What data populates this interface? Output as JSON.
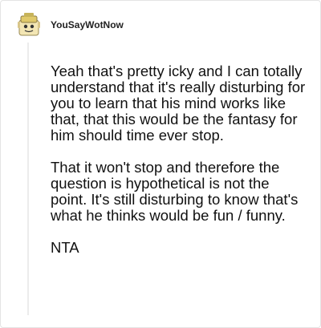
{
  "comment": {
    "author": {
      "username": "YouSayWotNow",
      "avatar_icon": "snoo-avatar-icon"
    },
    "paragraphs": [
      "Yeah that's pretty icky and I can totally understand that it's really disturbing for you to learn that his mind works like that, that this would be the fantasy for him should time ever stop.",
      "That it won't stop and therefore the question is hypothetical is not the point. It's still disturbing to know that's what he thinks would be fun / funny.",
      "NTA"
    ]
  }
}
